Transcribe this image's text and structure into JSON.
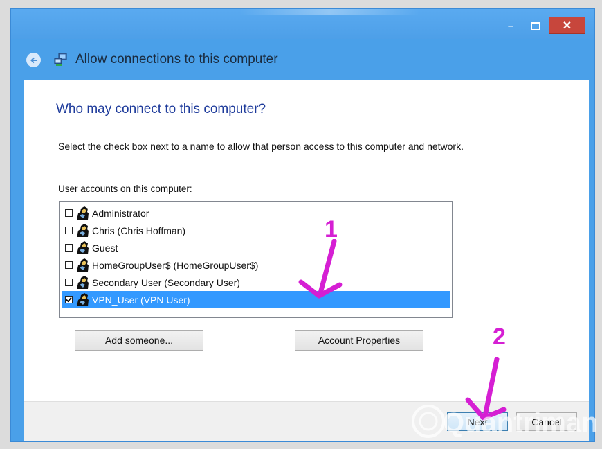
{
  "window": {
    "title": "Allow connections to this computer",
    "controls": {
      "minimize": "–",
      "close": "✕"
    }
  },
  "page": {
    "heading": "Who may connect to this computer?",
    "instructions": "Select the check box next to a name to allow that person access to this computer and network.",
    "list_label": "User accounts on this computer:"
  },
  "users": [
    {
      "name": "Administrator",
      "checked": false,
      "selected": false
    },
    {
      "name": "Chris (Chris Hoffman)",
      "checked": false,
      "selected": false
    },
    {
      "name": "Guest",
      "checked": false,
      "selected": false
    },
    {
      "name": "HomeGroupUser$ (HomeGroupUser$)",
      "checked": false,
      "selected": false
    },
    {
      "name": "Secondary User (Secondary User)",
      "checked": false,
      "selected": false
    },
    {
      "name": "VPN_User (VPN User)",
      "checked": true,
      "selected": true
    }
  ],
  "buttons": {
    "add": "Add someone...",
    "properties": "Account Properties",
    "next": "Next",
    "cancel": "Cancel"
  },
  "annotations": {
    "step1": "1",
    "step2": "2",
    "color": "#d51fd3"
  },
  "colors": {
    "title_band": "#4aa0e9",
    "heading": "#1e3b9b",
    "selection": "#3399ff",
    "close": "#c7463c"
  },
  "watermark": "Quantrimang"
}
